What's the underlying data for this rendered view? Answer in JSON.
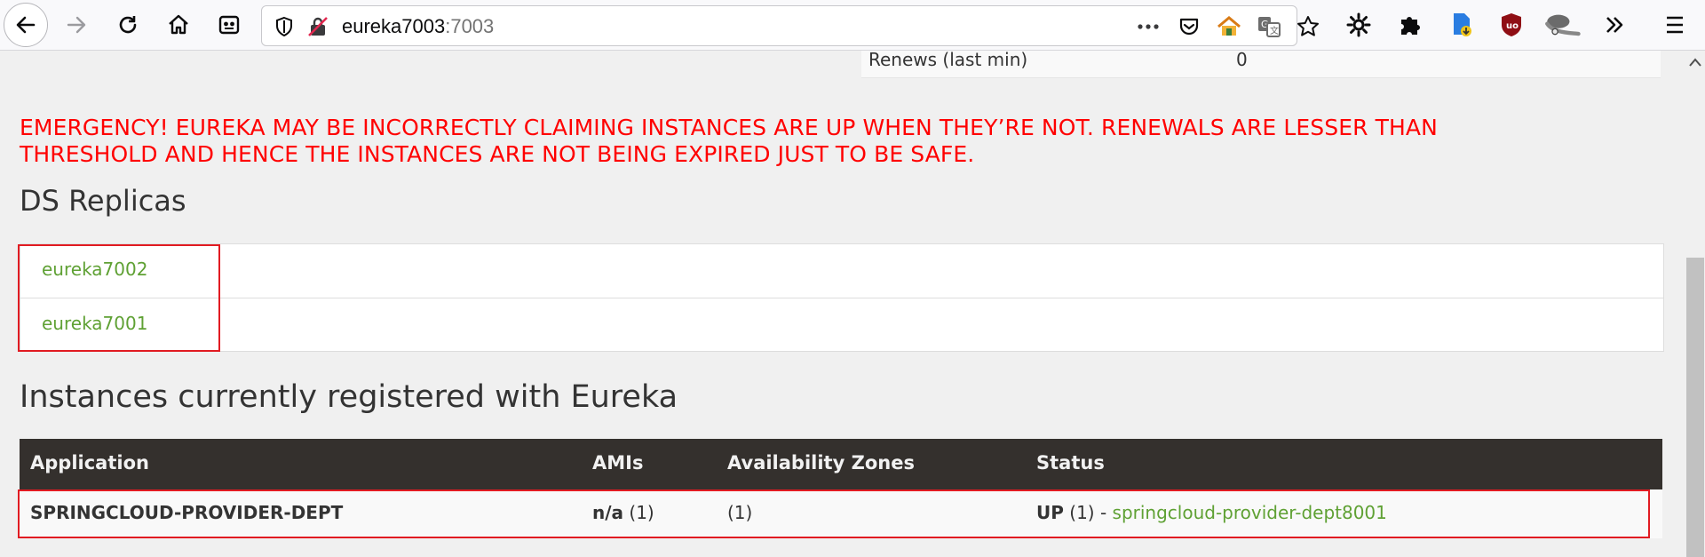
{
  "browser": {
    "url_host": "eureka7003",
    "url_port": ":7003",
    "icons": [
      "back-arrow-icon",
      "forward-arrow-icon",
      "reload-icon",
      "home-icon",
      "reader-view-icon",
      "shield-icon",
      "insecure-lock-icon",
      "more-dots-icon",
      "pocket-icon",
      "home-extension-icon",
      "translate-icon",
      "bookmark-star-icon",
      "settings-gear-icon",
      "extensions-puzzle-icon",
      "download-doc-icon",
      "ublock-icon",
      "overflow-chevron-icon",
      "menu-hamburger-icon"
    ]
  },
  "general": {
    "renews_label": "Renews (last min)",
    "renews_value": "0"
  },
  "emergency": {
    "line1": "EMERGENCY! EUREKA MAY BE INCORRECTLY CLAIMING INSTANCES ARE UP WHEN THEY’RE NOT. RENEWALS ARE LESSER THAN",
    "line2": "THRESHOLD AND HENCE THE INSTANCES ARE NOT BEING EXPIRED JUST TO BE SAFE.",
    "color": "#ff0000"
  },
  "replicas": {
    "title": "DS Replicas",
    "items": [
      "eureka7002",
      "eureka7001"
    ]
  },
  "instances": {
    "title": "Instances currently registered with Eureka",
    "headers": [
      "Application",
      "AMIs",
      "Availability Zones",
      "Status"
    ],
    "rows": [
      {
        "application": "SPRINGCLOUD-PROVIDER-DEPT",
        "amis_bold": "n/a",
        "amis_count": " (1)",
        "zones": "(1)",
        "status_bold": "UP",
        "status_count": " (1) - ",
        "status_link": "springcloud-provider-dept8001"
      }
    ]
  },
  "colors": {
    "link": "#5fa134",
    "table_header_bg": "#34302d",
    "highlight_box": "#e11b22"
  }
}
